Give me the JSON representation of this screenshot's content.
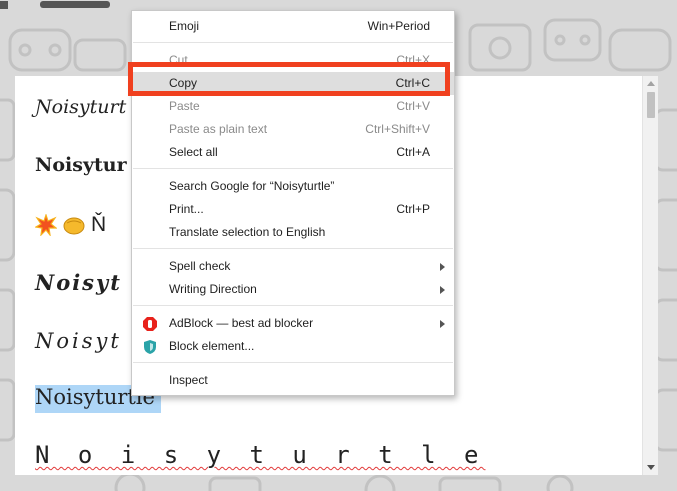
{
  "content": {
    "lines": [
      "Noisyturtle",
      "Noisyturtle",
      "Ňoisyturtle",
      "Noisyturtle",
      "Noisyturtle",
      "Noisyturtle",
      "N o i s y t u r t l e"
    ],
    "line1_text": "Ɲoisyturt",
    "line2_text": "Noisytur",
    "line3_text": "Ň",
    "line4_text": "Noisyt",
    "line5_text": "Noisyt",
    "line6_selected": "Noisyturtle",
    "line7_text": "N o i s y t u r t l e"
  },
  "context_menu": {
    "emoji": {
      "label": "Emoji",
      "shortcut": "Win+Period"
    },
    "cut": {
      "label": "Cut",
      "shortcut": "Ctrl+X"
    },
    "copy": {
      "label": "Copy",
      "shortcut": "Ctrl+C"
    },
    "paste": {
      "label": "Paste",
      "shortcut": "Ctrl+V"
    },
    "paste_plain": {
      "label": "Paste as plain text",
      "shortcut": "Ctrl+Shift+V"
    },
    "select_all": {
      "label": "Select all",
      "shortcut": "Ctrl+A"
    },
    "search_google": {
      "label": "Search Google for “Noisyturtle”"
    },
    "print": {
      "label": "Print...",
      "shortcut": "Ctrl+P"
    },
    "translate": {
      "label": "Translate selection to English"
    },
    "spell_check": {
      "label": "Spell check"
    },
    "writing_direction": {
      "label": "Writing Direction"
    },
    "adblock": {
      "label": "AdBlock — best ad blocker"
    },
    "block_element": {
      "label": "Block element..."
    },
    "inspect": {
      "label": "Inspect"
    }
  },
  "colors": {
    "highlight": "#f0401f",
    "selection": "#aed6f7",
    "adblock_red": "#e8221b",
    "block_teal": "#2aa3a8"
  }
}
